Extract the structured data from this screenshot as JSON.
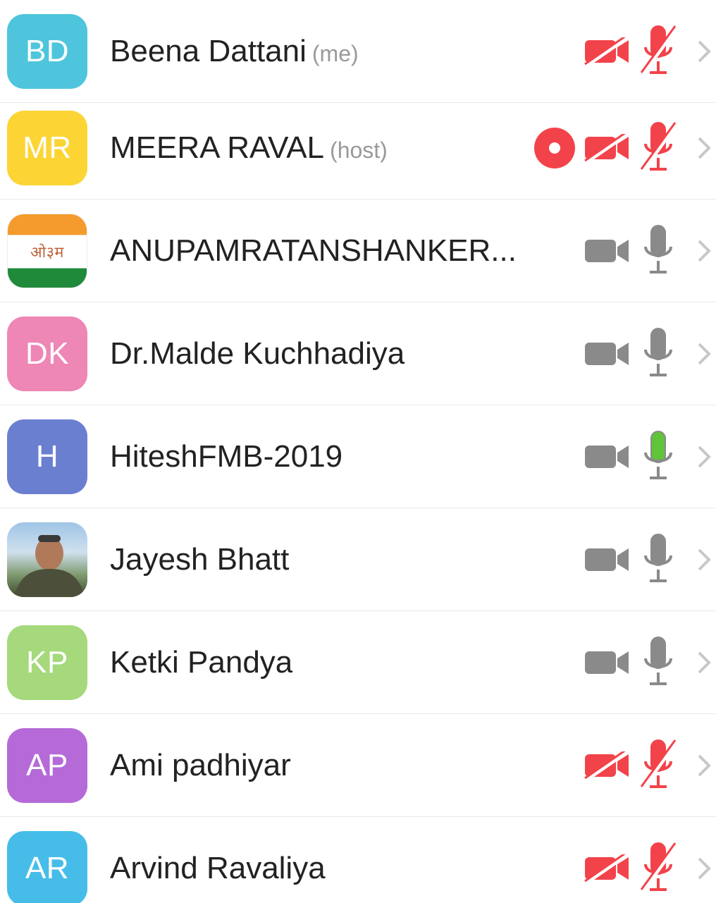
{
  "colors": {
    "muted_red": "#f2434a",
    "icon_gray": "#8a8a8a",
    "active_green": "#5fc43a",
    "chevron": "#c8c8c8"
  },
  "participants": [
    {
      "initials": "BD",
      "name": "Beena Dattani",
      "role": "(me)",
      "avatar_color": "#4ec5dc",
      "video": "off",
      "audio": "off",
      "recording": false
    },
    {
      "initials": "MR",
      "name": "MEERA RAVAL",
      "role": "(host)",
      "avatar_color": "#fcd535",
      "video": "off",
      "audio": "off",
      "recording": true
    },
    {
      "initials": "",
      "avatar_text": "ओ३म",
      "name": "ANUPAMRATANSHANKER...",
      "role": "",
      "avatar_color": "#ffffff",
      "video": "on",
      "audio": "on",
      "recording": false
    },
    {
      "initials": "DK",
      "name": "Dr.Malde Kuchhadiya",
      "role": "",
      "avatar_color": "#ee86b6",
      "video": "on",
      "audio": "on",
      "recording": false
    },
    {
      "initials": "H",
      "name": "HiteshFMB-2019",
      "role": "",
      "avatar_color": "#6b7fd1",
      "video": "on",
      "audio": "speaking",
      "recording": false
    },
    {
      "initials": "",
      "name": "Jayesh Bhatt",
      "role": "",
      "avatar_color": "#9fc4e6",
      "video": "on",
      "audio": "on",
      "recording": false
    },
    {
      "initials": "KP",
      "name": "Ketki Pandya",
      "role": "",
      "avatar_color": "#a5d97c",
      "video": "on",
      "audio": "on",
      "recording": false
    },
    {
      "initials": "AP",
      "name": "Ami padhiyar",
      "role": "",
      "avatar_color": "#b56ad8",
      "video": "off",
      "audio": "off",
      "recording": false
    },
    {
      "initials": "AR",
      "name": "Arvind Ravaliya",
      "role": "",
      "avatar_color": "#46bde8",
      "video": "off",
      "audio": "off",
      "recording": false
    }
  ]
}
